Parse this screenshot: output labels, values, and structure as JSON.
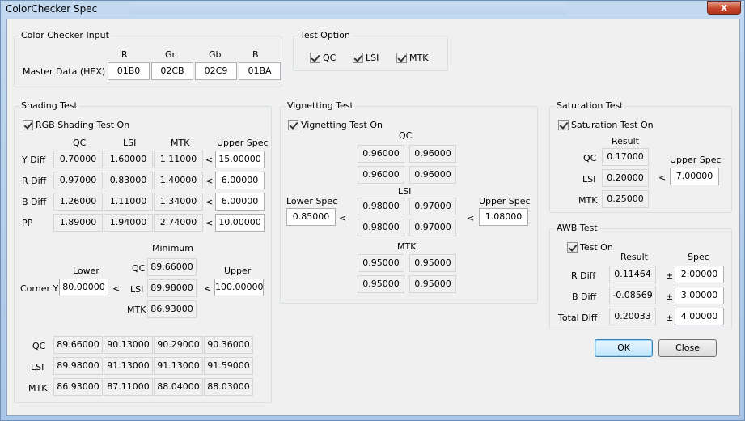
{
  "window": {
    "title": "ColorChecker Spec",
    "close_glyph": "x"
  },
  "color_checker_input": {
    "title": "Color Checker Input",
    "row_label": "Master Data (HEX)",
    "headers": [
      "R",
      "Gr",
      "Gb",
      "B"
    ],
    "values": [
      "01B0",
      "02CB",
      "02C9",
      "01BA"
    ]
  },
  "test_option": {
    "title": "Test Option",
    "options": [
      {
        "label": "QC",
        "checked": true
      },
      {
        "label": "LSI",
        "checked": true
      },
      {
        "label": "MTK",
        "checked": true
      }
    ]
  },
  "shading_test": {
    "title": "Shading Test",
    "checkbox_label": "RGB Shading Test On",
    "headers": [
      "QC",
      "LSI",
      "MTK",
      "Upper Spec"
    ],
    "rows": [
      {
        "label": "Y Diff",
        "values": [
          "0.70000",
          "1.60000",
          "1.11000"
        ],
        "lt": "<",
        "upper": "15.00000"
      },
      {
        "label": "R Diff",
        "values": [
          "0.97000",
          "0.83000",
          "1.40000"
        ],
        "lt": "<",
        "upper": "6.00000"
      },
      {
        "label": "B Diff",
        "values": [
          "1.26000",
          "1.11000",
          "1.34000"
        ],
        "lt": "<",
        "upper": "6.00000"
      },
      {
        "label": "PP",
        "values": [
          "1.89000",
          "1.94000",
          "2.74000"
        ],
        "lt": "<",
        "upper": "10.00000"
      }
    ],
    "corner": {
      "label": "Corner Y",
      "lower_label": "Lower",
      "lower": "80.00000",
      "lt1": "<",
      "minimum_label": "Minimum",
      "minimum": [
        {
          "label": "QC",
          "value": "89.66000"
        },
        {
          "label": "LSI",
          "value": "89.98000"
        },
        {
          "label": "MTK",
          "value": "86.93000"
        }
      ],
      "lt2": "<",
      "upper_label": "Upper",
      "upper": "100.00000"
    },
    "corner_table": [
      {
        "label": "QC",
        "values": [
          "89.66000",
          "90.13000",
          "90.29000",
          "90.36000"
        ]
      },
      {
        "label": "LSI",
        "values": [
          "89.98000",
          "91.13000",
          "91.13000",
          "91.59000"
        ]
      },
      {
        "label": "MTK",
        "values": [
          "86.93000",
          "87.11000",
          "88.04000",
          "88.03000"
        ]
      }
    ]
  },
  "vignetting_test": {
    "title": "Vignetting Test",
    "checkbox_label": "Vignetting Test On",
    "lower_label": "Lower Spec",
    "lower": "0.85000",
    "upper_label": "Upper Spec",
    "upper": "1.08000",
    "lt1": "<",
    "lt2": "<",
    "groups": [
      {
        "label": "QC",
        "values": [
          "0.96000",
          "0.96000",
          "0.96000",
          "0.96000"
        ]
      },
      {
        "label": "LSI",
        "values": [
          "0.98000",
          "0.97000",
          "0.98000",
          "0.97000"
        ]
      },
      {
        "label": "MTK",
        "values": [
          "0.95000",
          "0.95000",
          "0.95000",
          "0.95000"
        ]
      }
    ]
  },
  "saturation_test": {
    "title": "Saturation Test",
    "checkbox_label": "Saturation Test On",
    "result_label": "Result",
    "upper_label": "Upper Spec",
    "upper": "7.00000",
    "lt": "<",
    "rows": [
      {
        "label": "QC",
        "value": "0.17000"
      },
      {
        "label": "LSI",
        "value": "0.20000"
      },
      {
        "label": "MTK",
        "value": "0.25000"
      }
    ]
  },
  "awb_test": {
    "title": "AWB Test",
    "checkbox_label": "Test On",
    "result_label": "Result",
    "spec_label": "Spec",
    "pm": "±",
    "rows": [
      {
        "label": "R Diff",
        "result": "0.11464",
        "spec": "2.00000"
      },
      {
        "label": "B Diff",
        "result": "-0.08569",
        "spec": "3.00000"
      },
      {
        "label": "Total Diff",
        "result": "0.20033",
        "spec": "4.00000"
      }
    ]
  },
  "buttons": {
    "ok": "OK",
    "close": "Close"
  }
}
